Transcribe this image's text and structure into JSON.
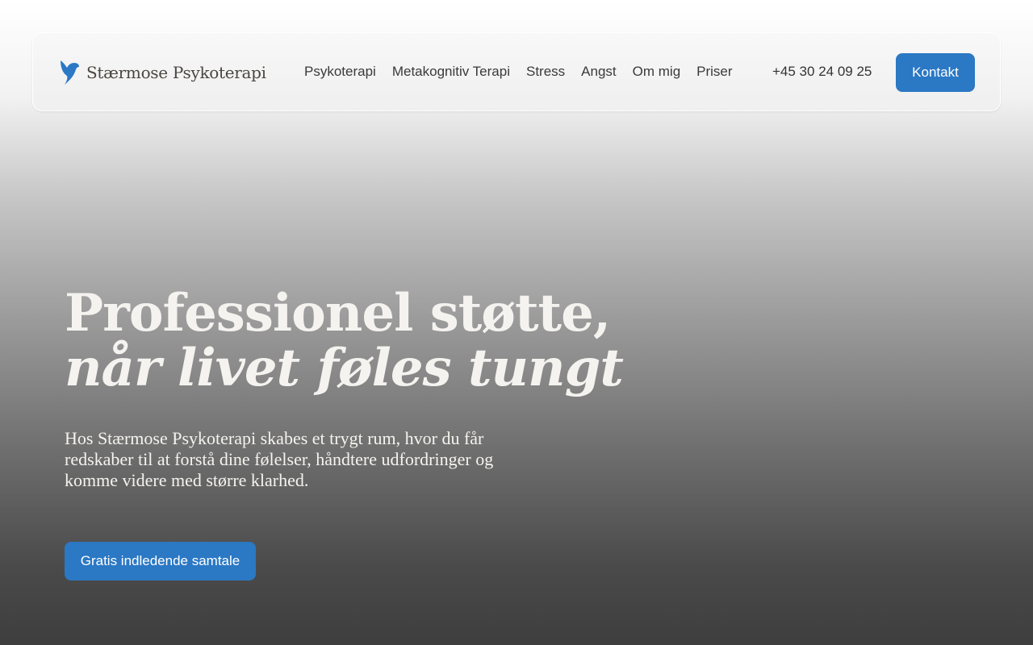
{
  "brand": {
    "name": "Stærmose Psykoterapi"
  },
  "nav": {
    "links": [
      "Psykoterapi",
      "Metakognitiv Terapi",
      "Stress",
      "Angst",
      "Om mig",
      "Priser"
    ],
    "phone": "+45 30 24 09 25",
    "contact_label": "Kontakt"
  },
  "hero": {
    "title_plain": "Professionel støtte, ",
    "title_italic": "når livet føles tungt",
    "subtitle": "Hos Stærmose Psykoterapi skabes et trygt rum, hvor du får redskaber til at forstå dine følelser, håndtere udfordringer og komme videre med større klarhed.",
    "cta_label": "Gratis indledende samtale"
  },
  "colors": {
    "accent": "#2b78c4"
  }
}
